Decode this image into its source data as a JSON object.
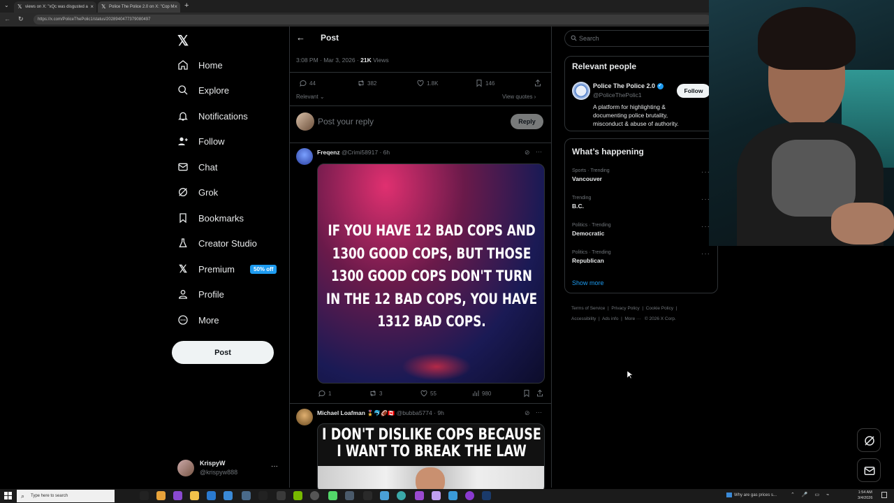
{
  "browser": {
    "tabs": [
      {
        "title": "views on X: \"xQc was disgusted a"
      },
      {
        "title": "Police The Police 2.0 on X: \"Cop M"
      }
    ],
    "url": "https://x.com/PoliceThePolic1/status/2028940477379080497"
  },
  "nav": {
    "items": [
      {
        "label": "Home",
        "icon": "home-icon"
      },
      {
        "label": "Explore",
        "icon": "search-icon"
      },
      {
        "label": "Notifications",
        "icon": "bell-icon"
      },
      {
        "label": "Follow",
        "icon": "person-add-icon"
      },
      {
        "label": "Chat",
        "icon": "mail-icon"
      },
      {
        "label": "Grok",
        "icon": "grok-icon"
      },
      {
        "label": "Bookmarks",
        "icon": "bookmark-icon"
      },
      {
        "label": "Creator Studio",
        "icon": "flask-icon"
      },
      {
        "label": "Premium",
        "icon": "x-logo-icon"
      },
      {
        "label": "Profile",
        "icon": "person-icon"
      },
      {
        "label": "More",
        "icon": "more-circle-icon"
      }
    ],
    "premium_badge": "50% off",
    "post_button": "Post",
    "account": {
      "name": "KrispyW",
      "handle": "@krispyw888"
    }
  },
  "post": {
    "header_title": "Post",
    "time": "3:08 PM · Mar 3, 2026 · ",
    "views_count": "21K",
    "views_label": " Views",
    "stats": {
      "replies": "44",
      "reposts": "382",
      "likes": "1.8K",
      "bookmarks": "146"
    },
    "sort_label": "Relevant",
    "view_quotes": "View quotes",
    "reply_placeholder": "Post your reply",
    "reply_button": "Reply"
  },
  "replies": [
    {
      "name": "Freqenz",
      "handle": "@Crimi58917",
      "time": "6h",
      "image_text": [
        "IF YOU HAVE 12 BAD COPS AND",
        "1300 GOOD COPS, BUT THOSE",
        "1300 GOOD COPS DON'T TURN",
        "IN THE 12 BAD COPS, YOU HAVE",
        "1312 BAD COPS."
      ],
      "stats": {
        "replies": "1",
        "reposts": "3",
        "likes": "55",
        "views": "980"
      }
    },
    {
      "name": "Michael Loafman",
      "handle": "@bubba5774",
      "time": "9h",
      "image_text": [
        "I DON'T DISLIKE COPS BECAUSE",
        "I WANT TO BREAK THE LAW"
      ]
    }
  ],
  "right": {
    "search_placeholder": "Search",
    "relevant": {
      "title": "Relevant people",
      "name": "Police The Police 2.0",
      "handle": "@PoliceThePolic1",
      "follow": "Follow",
      "bio": "A platform for highlighting & documenting police brutality, misconduct & abuse of authority."
    },
    "happening": {
      "title": "What’s happening",
      "trends": [
        {
          "meta": "Sports · Trending",
          "name": "Vancouver"
        },
        {
          "meta": "Trending",
          "name": "B.C."
        },
        {
          "meta": "Politics · Trending",
          "name": "Democratic"
        },
        {
          "meta": "Politics · Trending",
          "name": "Republican"
        }
      ],
      "show_more": "Show more"
    },
    "footer": {
      "links1": [
        "Terms of Service",
        "Privacy Policy",
        "Cookie Policy"
      ],
      "links2": [
        "Accessibility",
        "Ads info",
        "More ···",
        "© 2026 X Corp."
      ]
    }
  },
  "taskbar": {
    "search_placeholder": "Type here to search",
    "notification_text": "Why are gas prices s...",
    "time": "1:54 AM",
    "date": "3/4/2026"
  },
  "colors": {
    "accent": "#1d9bf0",
    "background": "#000000",
    "border": "#2f3336",
    "muted": "#71767b"
  }
}
